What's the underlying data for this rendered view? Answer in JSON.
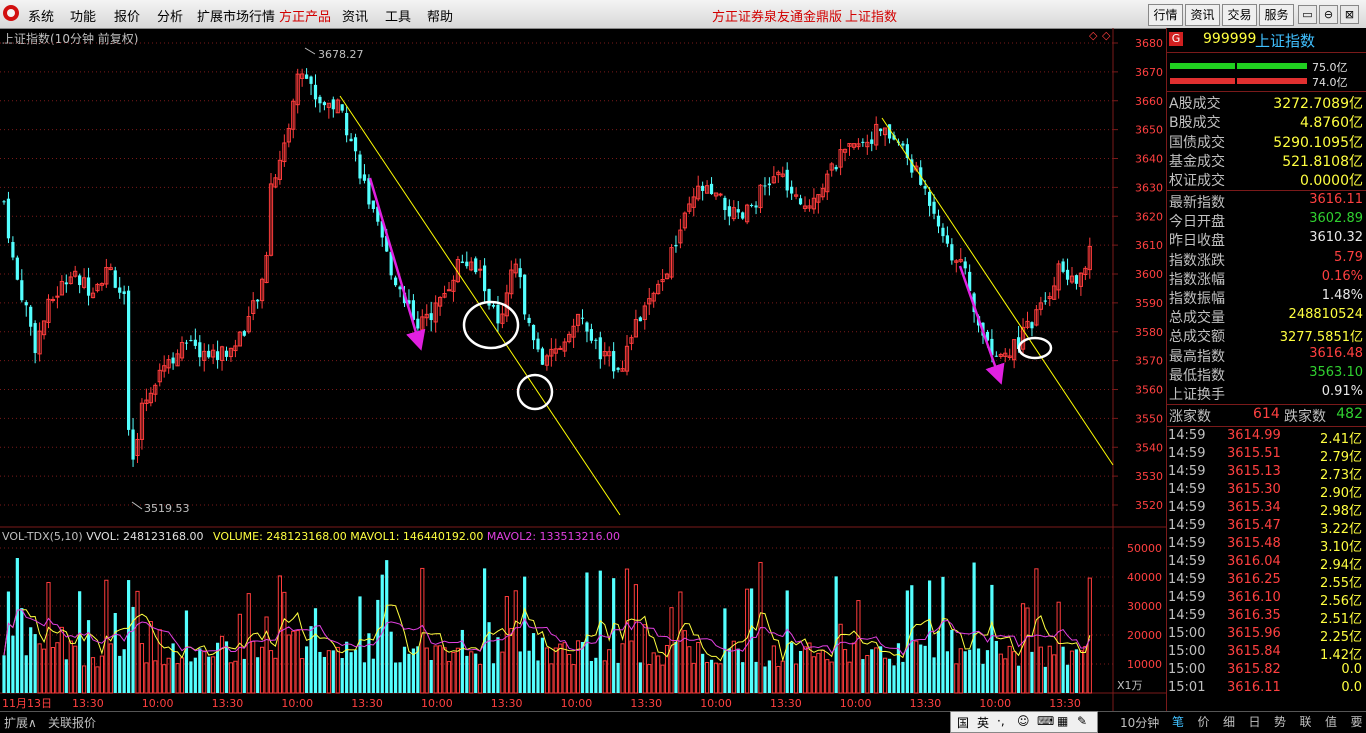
{
  "menubar": {
    "items": [
      "系统",
      "功能",
      "报价",
      "分析",
      "扩展市场行情",
      "方正产品",
      "资讯",
      "工具",
      "帮助"
    ],
    "active_item": "方正产品",
    "window_title": "方正证券泉友通金鼎版",
    "window_subtitle": "上证指数",
    "right_buttons": [
      "行情",
      "资讯",
      "交易",
      "服务"
    ],
    "window_controls": [
      "▭",
      "⊖",
      "⊠"
    ]
  },
  "chart": {
    "title": "上证指数(10分钟 前复权)",
    "high_label": "3678.27",
    "low_label": "3519.53",
    "price_ticks": [
      "3680",
      "3670",
      "3660",
      "3650",
      "3640",
      "3630",
      "3620",
      "3610",
      "3600",
      "3590",
      "3580",
      "3570",
      "3560",
      "3550",
      "3540",
      "3530",
      "3520"
    ],
    "volume_legend": {
      "name": "VOL-TDX(5,10)",
      "vvol": "VVOL: 248123168.00",
      "volume": "VOLUME: 248123168.00",
      "mavol1": "MAVOL1: 146440192.00",
      "mavol2": "MAVOL2: 133513216.00"
    },
    "volume_ticks": [
      "50000",
      "40000",
      "30000",
      "20000",
      "10000"
    ],
    "volume_unit": "X1万",
    "period": "10分钟",
    "time_labels": [
      "11月13日",
      "13:30",
      "10:00",
      "13:30",
      "10:00",
      "13:30",
      "10:00",
      "13:30",
      "10:00",
      "13:30",
      "10:00",
      "13:30",
      "10:00",
      "13:30",
      "10:00",
      "13:30"
    ],
    "colors": {
      "up": "#ff3c3c",
      "down": "#54ffff",
      "trend": "#ffff00",
      "arrow": "#e020e0",
      "grid": "#7a1a1a"
    }
  },
  "info": {
    "code_badge": "G",
    "code": "999999",
    "name": "上证指数",
    "bar1_value": "75.0亿",
    "bar2_value": "74.0亿",
    "turnover": [
      {
        "label": "A股成交",
        "value": "3272.7089亿"
      },
      {
        "label": "B股成交",
        "value": "4.8760亿"
      },
      {
        "label": "国债成交",
        "value": "5290.1095亿"
      },
      {
        "label": "基金成交",
        "value": "521.8108亿"
      },
      {
        "label": "权证成交",
        "value": "0.0000亿"
      }
    ],
    "stats": [
      {
        "label": "最新指数",
        "value": "3616.11",
        "color": "red"
      },
      {
        "label": "今日开盘",
        "value": "3602.89",
        "color": "green"
      },
      {
        "label": "昨日收盘",
        "value": "3610.32",
        "color": "white"
      },
      {
        "label": "指数涨跌",
        "value": "5.79",
        "color": "red"
      },
      {
        "label": "指数涨幅",
        "value": "0.16%",
        "color": "red"
      },
      {
        "label": "指数振幅",
        "value": "1.48%",
        "color": "white"
      },
      {
        "label": "总成交量",
        "value": "248810524",
        "color": "yellow"
      },
      {
        "label": "总成交额",
        "value": "3277.5851亿",
        "color": "yellow"
      },
      {
        "label": "最高指数",
        "value": "3616.48",
        "color": "red"
      },
      {
        "label": "最低指数",
        "value": "3563.10",
        "color": "green"
      },
      {
        "label": "上证换手",
        "value": "0.91%",
        "color": "white"
      }
    ],
    "up_label": "涨家数",
    "up_count": "614",
    "down_label": "跌家数",
    "down_count": "482",
    "ticks": [
      {
        "time": "14:59",
        "price": "3614.99",
        "vol": "2.41亿"
      },
      {
        "time": "14:59",
        "price": "3615.51",
        "vol": "2.79亿"
      },
      {
        "time": "14:59",
        "price": "3615.13",
        "vol": "2.73亿"
      },
      {
        "time": "14:59",
        "price": "3615.30",
        "vol": "2.90亿"
      },
      {
        "time": "14:59",
        "price": "3615.34",
        "vol": "2.98亿"
      },
      {
        "time": "14:59",
        "price": "3615.47",
        "vol": "3.22亿"
      },
      {
        "time": "14:59",
        "price": "3615.48",
        "vol": "3.10亿"
      },
      {
        "time": "14:59",
        "price": "3616.04",
        "vol": "2.94亿"
      },
      {
        "time": "14:59",
        "price": "3616.25",
        "vol": "2.55亿"
      },
      {
        "time": "14:59",
        "price": "3616.10",
        "vol": "2.56亿"
      },
      {
        "time": "14:59",
        "price": "3616.35",
        "vol": "2.51亿"
      },
      {
        "time": "15:00",
        "price": "3615.96",
        "vol": "2.25亿"
      },
      {
        "time": "15:00",
        "price": "3615.84",
        "vol": "1.42亿"
      },
      {
        "time": "15:00",
        "price": "3615.82",
        "vol": "0.0"
      },
      {
        "time": "15:01",
        "price": "3616.11",
        "vol": "0.0"
      }
    ],
    "tabs": [
      "笔",
      "价",
      "细",
      "日",
      "势",
      "联",
      "值",
      "要"
    ]
  },
  "bottom": {
    "items": [
      "扩展∧",
      "关联报价"
    ],
    "ime": [
      "国",
      "英",
      "·,",
      "☺",
      "⌨",
      "▦",
      "✎"
    ]
  }
}
